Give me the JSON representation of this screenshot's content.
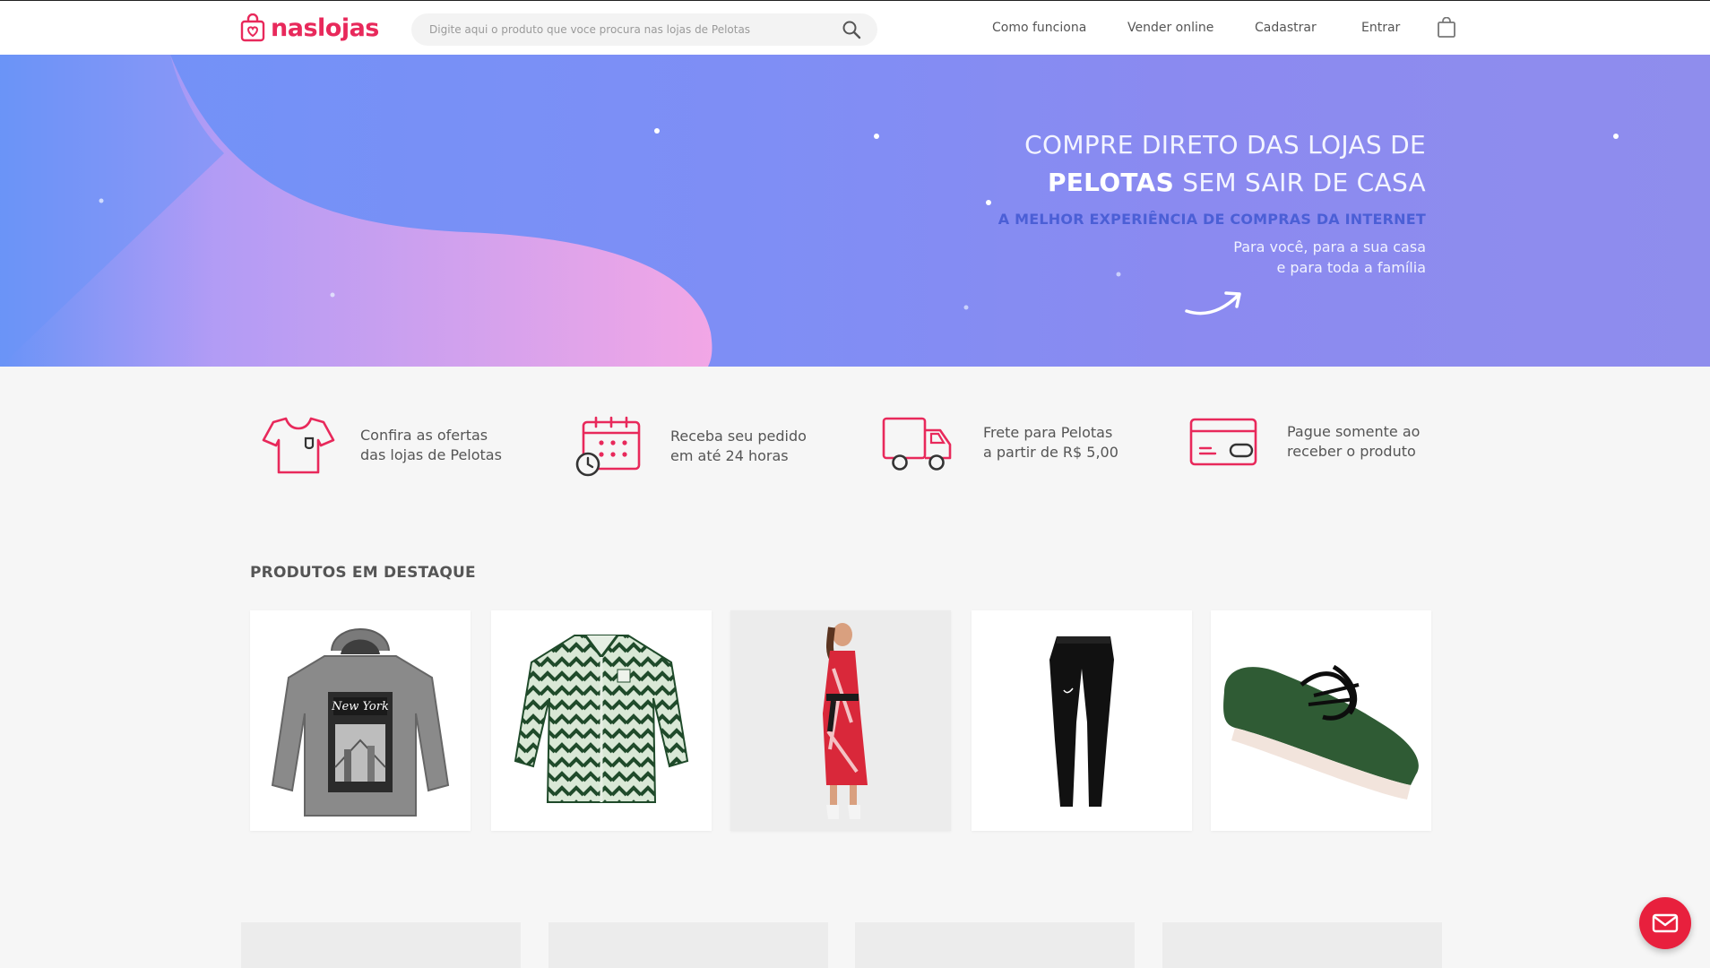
{
  "header": {
    "logo_text": "naslojas",
    "search": {
      "placeholder": "Digite aqui o produto que voce procura nas lojas de Pelotas",
      "value": ""
    },
    "nav": [
      "Como funciona",
      "Vender online",
      "Cadastrar",
      "Entrar"
    ]
  },
  "hero": {
    "line1": "COMPRE DIRETO DAS LOJAS DE",
    "line2_bold": "PELOTAS",
    "line2_rest": " SEM SAIR DE CASA",
    "subtitle": "A MELHOR EXPERIÊNCIA DE COMPRAS DA INTERNET",
    "para_line1": "Para você, para a sua casa",
    "para_line2": "e para toda a família"
  },
  "features": [
    {
      "icon": "tshirt-icon",
      "line1": "Confira as ofertas",
      "line2": "das lojas de Pelotas"
    },
    {
      "icon": "calendar-clock-icon",
      "line1": "Receba seu pedido",
      "line2": "em até 24 horas"
    },
    {
      "icon": "truck-icon",
      "line1": "Frete para Pelotas",
      "line2": "a partir de R$ 5,00"
    },
    {
      "icon": "credit-card-icon",
      "line1": "Pague somente ao",
      "line2": "receber o produto"
    }
  ],
  "products_section": {
    "title": "PRODUTOS EM DESTAQUE",
    "products": [
      {
        "image": "grey-new-york-hoodie"
      },
      {
        "image": "green-patterned-shirt"
      },
      {
        "image": "red-wrap-dress-model"
      },
      {
        "image": "black-nike-leggings"
      },
      {
        "image": "green-sneaker"
      }
    ]
  },
  "colors": {
    "brand": "#e8295b",
    "hero_blue": "#7f8ef5",
    "hero_pink": "#f7a6e6",
    "fab": "#e8203d"
  },
  "fab": {
    "icon": "mail-icon"
  }
}
